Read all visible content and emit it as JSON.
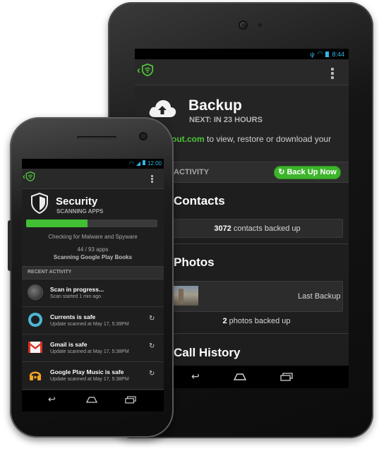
{
  "tablet": {
    "status": {
      "time": "8:44"
    },
    "backup": {
      "title": "Backup",
      "next": "NEXT: IN 23 HOURS",
      "desc_link": "okout.com",
      "desc_rest": " to view, restore or download your"
    },
    "activity": {
      "label": "ACTIVITY",
      "button": "Back Up Now"
    },
    "contacts": {
      "title": "Contacts",
      "count": "3072",
      "rest": " contacts backed up"
    },
    "photos": {
      "title": "Photos",
      "last_backup": "Last Backup",
      "count": "2",
      "rest": " photos backed up"
    },
    "call_history": {
      "title": "Call History"
    }
  },
  "phone": {
    "status": {
      "time": "12:00"
    },
    "security": {
      "title": "Security",
      "subtitle": "SCANNING APPS",
      "progress": 0.47,
      "checking": "Checking for Malware and Spyware",
      "counts": "44 / 93 apps",
      "scanning": "Scanning Google Play Books"
    },
    "recent_label": "RECENT ACTIVITY",
    "items": [
      {
        "title": "Scan in progress...",
        "sub": "Scan started 1 min ago",
        "icon": "scan-icon"
      },
      {
        "title": "Currents is safe",
        "sub": "Update scanned at May 17, 5:39PM",
        "icon": "currents-icon"
      },
      {
        "title": "Gmail is safe",
        "sub": "Update scanned at May 17, 5:38PM",
        "icon": "gmail-icon"
      },
      {
        "title": "Google Play Music is safe",
        "sub": "Update scanned at May 17, 5:38PM",
        "icon": "play-music-icon"
      }
    ]
  },
  "colors": {
    "accent": "#42c034",
    "holo_blue": "#33b5e5",
    "screen_bg": "#1e1e1e"
  }
}
